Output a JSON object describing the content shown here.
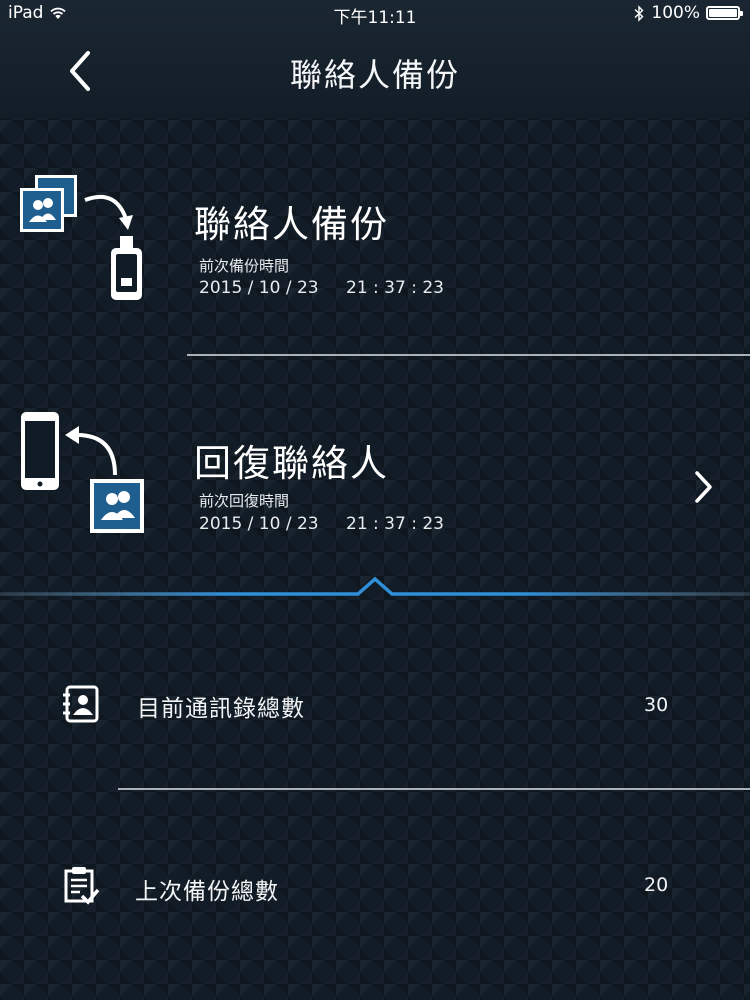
{
  "status_bar": {
    "device": "iPad",
    "time": "下午11:11",
    "battery": "100%",
    "battery_level": 1.0
  },
  "header": {
    "title": "聯絡人備份",
    "back_icon": "chevron-left-icon"
  },
  "backup": {
    "title": "聯絡人備份",
    "time_label": "前次備份時間",
    "date": "2015 / 10 / 23",
    "time": "21 : 37 : 23",
    "icon": "contacts-to-drive-icon"
  },
  "restore": {
    "title": "回復聯絡人",
    "time_label": "前次回復時間",
    "date": "2015 / 10 / 23",
    "time": "21 : 37 : 23",
    "icon": "restore-to-phone-icon",
    "arrow_icon": "chevron-right-icon"
  },
  "stats": [
    {
      "label": "目前通訊錄總數",
      "value": "30",
      "icon": "address-book-icon"
    },
    {
      "label": "上次備份總數",
      "value": "20",
      "icon": "clipboard-check-icon"
    }
  ],
  "colors": {
    "accent": "#2f8fd8",
    "background": "#121c26",
    "icon_blue": "#1f5f8f"
  }
}
